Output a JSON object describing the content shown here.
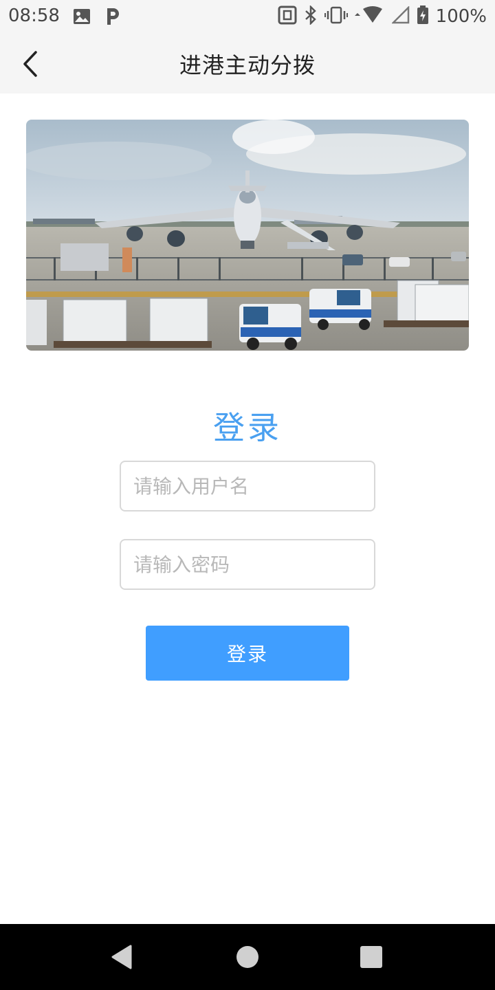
{
  "status_bar": {
    "time": "08:58",
    "battery": "100%",
    "icons": [
      "image-icon",
      "parking-p-icon",
      "nfc-icon",
      "bluetooth-icon",
      "vibrate-icon",
      "wifi-icon",
      "cell-signal-icon",
      "battery-icon"
    ]
  },
  "header": {
    "title": "进港主动分拨",
    "back_icon": "chevron-left-icon"
  },
  "login": {
    "heading": "登录",
    "username_placeholder": "请输入用户名",
    "password_placeholder": "请输入密码",
    "username_value": "",
    "password_value": "",
    "button_label": "登录"
  },
  "colors": {
    "accent": "#409eff",
    "heading": "#4aa0f0",
    "appbar_bg": "#f5f5f5",
    "navbar_bg": "#000000"
  },
  "nav_bar": {
    "icons": [
      "back-triangle-icon",
      "home-circle-icon",
      "recents-square-icon"
    ]
  }
}
